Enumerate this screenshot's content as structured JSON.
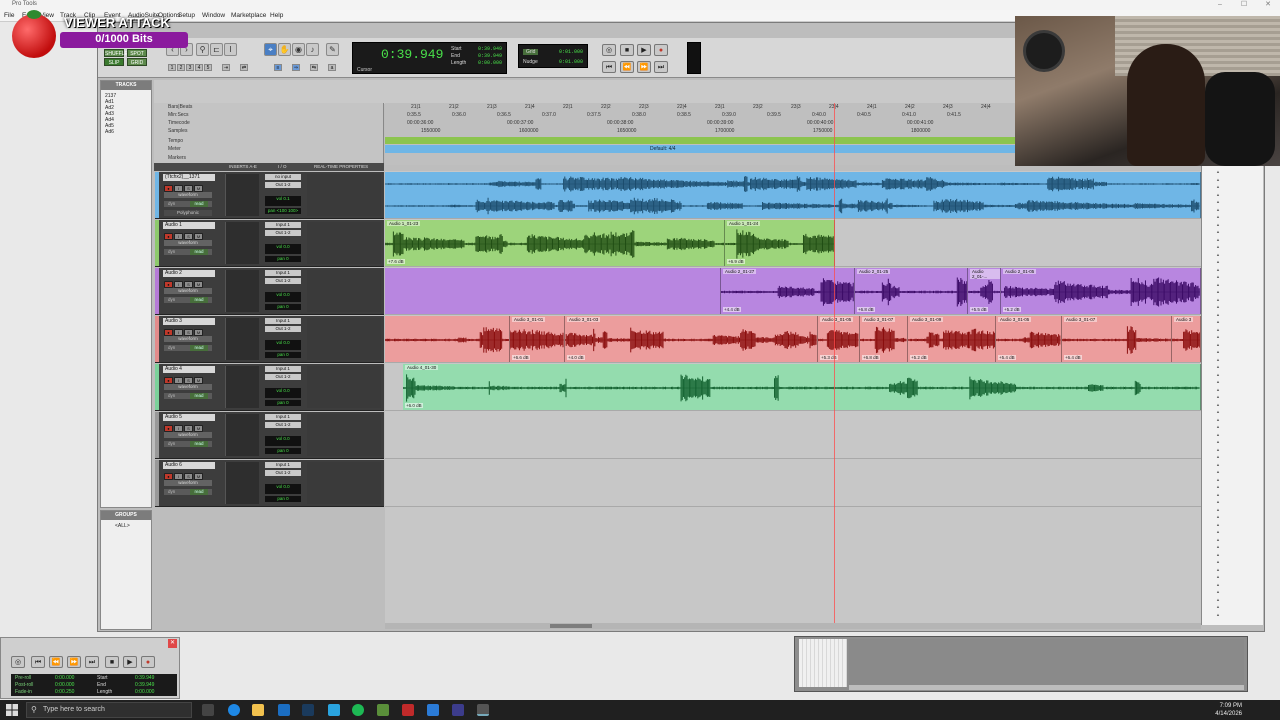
{
  "window": {
    "title": "Pro Tools"
  },
  "menu": {
    "items": [
      "File",
      "Edit",
      "View",
      "Track",
      "Clip",
      "Event",
      "AudioSuite",
      "Options",
      "Setup",
      "Window",
      "Marketplace",
      "Help"
    ]
  },
  "overlay": {
    "title": "VIEWER ATTACK",
    "bits": "0/1000 Bits"
  },
  "toolbar": {
    "mode_shuffle": "SHUFFLE",
    "mode_spot": "SPOT",
    "mode_slip": "SLIP",
    "mode_grid": "GRID",
    "counter_main": "0:39.949",
    "counter_cursor_label": "Cursor",
    "start_label": "Start",
    "start_val": "0:39.949",
    "end_label": "End",
    "end_val": "0:39.949",
    "length_label": "Length",
    "length_val": "0:00.000",
    "grid_label": "Grid",
    "grid_val": "0:01.000",
    "nudge_label": "Nudge",
    "nudge_val": "0:01.000"
  },
  "tracks_panel": {
    "header": "TRACKS",
    "items": [
      "2137",
      "Ad1",
      "Ad2",
      "Ad3",
      "Ad4",
      "Ad5",
      "Ad6"
    ]
  },
  "groups_panel": {
    "header": "GROUPS",
    "item": "<ALL>"
  },
  "rulers": {
    "labels": [
      "Bars|Beats",
      "Min:Secs",
      "Timecode",
      "Samples",
      "Tempo",
      "Meter",
      "Markers"
    ],
    "bars": [
      "21|1",
      "21|2",
      "21|3",
      "21|4",
      "22|1",
      "22|2",
      "22|3",
      "22|4",
      "23|1",
      "23|2",
      "23|3",
      "23|4",
      "24|1",
      "24|2",
      "24|3",
      "24|4"
    ],
    "minsecs": [
      "0:35.5",
      "0:36.0",
      "0:36.5",
      "0:37.0",
      "0:37.5",
      "0:38.0",
      "0:38.5",
      "0:39.0",
      "0:39.5",
      "0:40.0",
      "0:40.5",
      "0:41.0",
      "0:41.5"
    ],
    "timecode": [
      "00:00:36:00",
      "00:00:37:00",
      "00:00:38:00",
      "00:00:39:00",
      "00:00:40:00",
      "00:00:41:00"
    ],
    "samples": [
      "1550000",
      "1600000",
      "1650000",
      "1700000",
      "1750000",
      "1800000"
    ],
    "meter_text": "Default: 4/4"
  },
  "columns": {
    "inserts": "INSERTS A-E",
    "io": "I / O",
    "rtp": "REAL-TIME PROPERTIES"
  },
  "track_common": {
    "view": "waveform",
    "dyn": "dyn",
    "auto": "read",
    "input": "Input 1",
    "output": "Out 1-2",
    "vol_label": "vol",
    "pan_label": "pan",
    "btn_rec": "●",
    "btn_input": "I",
    "btn_solo": "S",
    "btn_mute": "M"
  },
  "tracks": [
    {
      "name": "(Ttchx2)__1371",
      "input": "no input",
      "vol": "0.1",
      "pan": "<100  100>",
      "extra": "Polyphonic",
      "color": "#6fb6e6"
    },
    {
      "name": "Audio 1",
      "input": "Input 1",
      "vol": "0.0",
      "pan": "0",
      "extra": "",
      "color": "#8dc96b"
    },
    {
      "name": "Audio 2",
      "input": "Input 1",
      "vol": "0.0",
      "pan": "0",
      "extra": "",
      "color": "#b57ad6"
    },
    {
      "name": "Audio 3",
      "input": "Input 1",
      "vol": "0.0",
      "pan": "0",
      "extra": "",
      "color": "#e28a8a"
    },
    {
      "name": "Audio 4",
      "input": "Input 1",
      "vol": "0.0",
      "pan": "0",
      "extra": "",
      "color": "#7bd19a"
    },
    {
      "name": "Audio 5",
      "input": "Input 1",
      "vol": "0.0",
      "pan": "0",
      "extra": "",
      "color": "#999999"
    },
    {
      "name": "Audio 6",
      "input": "Input 1",
      "vol": "0.0",
      "pan": "0",
      "extra": "",
      "color": "#999999"
    }
  ],
  "clips": {
    "audio1": [
      {
        "name": "Audio 1_01-23",
        "gain": "+7.6 dB"
      },
      {
        "name": "Audio 1_01-24",
        "gain": "+6.9 dB"
      }
    ],
    "audio2": [
      {
        "name": "Audio 2_01-27",
        "gain": "+4.4 dB"
      },
      {
        "name": "Audio 2_01-25",
        "gain": "+6.8 dB"
      },
      {
        "name": "Audio 2_01-...",
        "gain": "+5.5 dB"
      },
      {
        "name": "Audio 2_01-05",
        "gain": "+5.2 dB"
      }
    ],
    "audio3": [
      {
        "name": "Audio 3_01-01",
        "gain": "+6.6 dB"
      },
      {
        "name": "Audio 3_01-03",
        "gain": "+4.0 dB"
      },
      {
        "name": "Audio 3_01-05",
        "gain": "+5.3 dB"
      },
      {
        "name": "Audio 3_01-07",
        "gain": "+6.8 dB"
      },
      {
        "name": "Audio 3_01-09",
        "gain": "+5.2 dB"
      },
      {
        "name": "Audio 3_01-05",
        "gain": "+5.4 dB"
      },
      {
        "name": "Audio 3_01-07",
        "gain": "+6.4 dB"
      },
      {
        "name": "Audio 3",
        "gain": ""
      }
    ],
    "audio4": [
      {
        "name": "Audio 4_01-30",
        "gain": "+6.0 dB"
      }
    ]
  },
  "minitransport": {
    "preroll_label": "Pre-roll",
    "preroll_val": "0:00.000",
    "postroll_label": "Post-roll",
    "postroll_val": "0:00.000",
    "fadein_label": "Fade-in",
    "fadein_val": "0:00.250",
    "start_label": "Start",
    "start_val": "0:39.949",
    "end_label": "End",
    "end_val": "0:39.949",
    "length_label": "Length",
    "length_val": "0:00.000"
  },
  "taskbar": {
    "search_placeholder": "Type here to search",
    "time": "7:09 PM",
    "date": "4/14/2026"
  },
  "colors": {
    "track0": "#6fb6e6",
    "wave0": "#1c4d6e",
    "track1": "#9dd47b",
    "wave1": "#214e14",
    "track2": "#b886e0",
    "wave2": "#3b0a66",
    "track3": "#ec9d9d",
    "wave3": "#8a0d0d",
    "track4": "#94dcae",
    "wave4": "#12612f"
  }
}
